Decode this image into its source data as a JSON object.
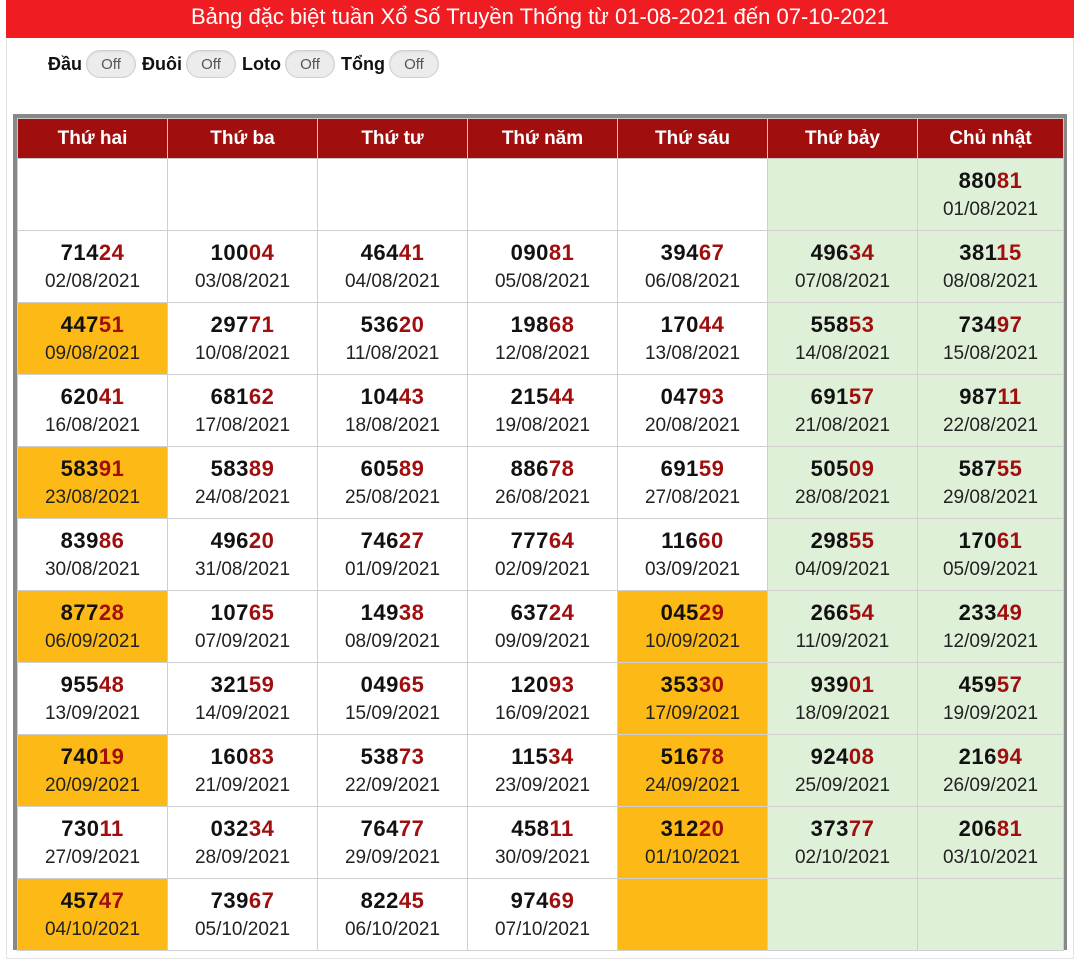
{
  "title": "Bảng đặc biệt tuần Xổ Số Truyền Thống từ 01-08-2021 đến 07-10-2021",
  "toggles": [
    {
      "label": "Đầu",
      "state": "Off"
    },
    {
      "label": "Đuôi",
      "state": "Off"
    },
    {
      "label": "Loto",
      "state": "Off"
    },
    {
      "label": "Tổng",
      "state": "Off"
    }
  ],
  "colors": {
    "title_bg": "#ef1c22",
    "header_bg": "#a10e0e",
    "last_digits": "#a10e0e",
    "weekend_bg": "#dff0d8",
    "highlight_bg": "#fdb915"
  },
  "headers": [
    "Thứ hai",
    "Thứ ba",
    "Thứ tư",
    "Thứ năm",
    "Thứ sáu",
    "Thứ bảy",
    "Chủ nhật"
  ],
  "rows": [
    [
      null,
      null,
      null,
      null,
      null,
      {
        "empty": true
      },
      {
        "num": "88081",
        "date": "01/08/2021"
      }
    ],
    [
      {
        "num": "71424",
        "date": "02/08/2021"
      },
      {
        "num": "10004",
        "date": "03/08/2021"
      },
      {
        "num": "46441",
        "date": "04/08/2021"
      },
      {
        "num": "09081",
        "date": "05/08/2021"
      },
      {
        "num": "39467",
        "date": "06/08/2021"
      },
      {
        "num": "49634",
        "date": "07/08/2021"
      },
      {
        "num": "38115",
        "date": "08/08/2021"
      }
    ],
    [
      {
        "num": "44751",
        "date": "09/08/2021",
        "hl": true
      },
      {
        "num": "29771",
        "date": "10/08/2021"
      },
      {
        "num": "53620",
        "date": "11/08/2021"
      },
      {
        "num": "19868",
        "date": "12/08/2021"
      },
      {
        "num": "17044",
        "date": "13/08/2021"
      },
      {
        "num": "55853",
        "date": "14/08/2021"
      },
      {
        "num": "73497",
        "date": "15/08/2021"
      }
    ],
    [
      {
        "num": "62041",
        "date": "16/08/2021"
      },
      {
        "num": "68162",
        "date": "17/08/2021"
      },
      {
        "num": "10443",
        "date": "18/08/2021"
      },
      {
        "num": "21544",
        "date": "19/08/2021"
      },
      {
        "num": "04793",
        "date": "20/08/2021"
      },
      {
        "num": "69157",
        "date": "21/08/2021"
      },
      {
        "num": "98711",
        "date": "22/08/2021"
      }
    ],
    [
      {
        "num": "58391",
        "date": "23/08/2021",
        "hl": true
      },
      {
        "num": "58389",
        "date": "24/08/2021"
      },
      {
        "num": "60589",
        "date": "25/08/2021"
      },
      {
        "num": "88678",
        "date": "26/08/2021"
      },
      {
        "num": "69159",
        "date": "27/08/2021"
      },
      {
        "num": "50509",
        "date": "28/08/2021"
      },
      {
        "num": "58755",
        "date": "29/08/2021"
      }
    ],
    [
      {
        "num": "83986",
        "date": "30/08/2021"
      },
      {
        "num": "49620",
        "date": "31/08/2021"
      },
      {
        "num": "74627",
        "date": "01/09/2021"
      },
      {
        "num": "77764",
        "date": "02/09/2021"
      },
      {
        "num": "11660",
        "date": "03/09/2021"
      },
      {
        "num": "29855",
        "date": "04/09/2021"
      },
      {
        "num": "17061",
        "date": "05/09/2021"
      }
    ],
    [
      {
        "num": "87728",
        "date": "06/09/2021",
        "hl": true
      },
      {
        "num": "10765",
        "date": "07/09/2021"
      },
      {
        "num": "14938",
        "date": "08/09/2021"
      },
      {
        "num": "63724",
        "date": "09/09/2021"
      },
      {
        "num": "04529",
        "date": "10/09/2021",
        "hl": true
      },
      {
        "num": "26654",
        "date": "11/09/2021"
      },
      {
        "num": "23349",
        "date": "12/09/2021"
      }
    ],
    [
      {
        "num": "95548",
        "date": "13/09/2021"
      },
      {
        "num": "32159",
        "date": "14/09/2021"
      },
      {
        "num": "04965",
        "date": "15/09/2021"
      },
      {
        "num": "12093",
        "date": "16/09/2021"
      },
      {
        "num": "35330",
        "date": "17/09/2021",
        "hl": true
      },
      {
        "num": "93901",
        "date": "18/09/2021"
      },
      {
        "num": "45957",
        "date": "19/09/2021"
      }
    ],
    [
      {
        "num": "74019",
        "date": "20/09/2021",
        "hl": true
      },
      {
        "num": "16083",
        "date": "21/09/2021"
      },
      {
        "num": "53873",
        "date": "22/09/2021"
      },
      {
        "num": "11534",
        "date": "23/09/2021"
      },
      {
        "num": "51678",
        "date": "24/09/2021",
        "hl": true
      },
      {
        "num": "92408",
        "date": "25/09/2021"
      },
      {
        "num": "21694",
        "date": "26/09/2021"
      }
    ],
    [
      {
        "num": "73011",
        "date": "27/09/2021"
      },
      {
        "num": "03234",
        "date": "28/09/2021"
      },
      {
        "num": "76477",
        "date": "29/09/2021"
      },
      {
        "num": "45811",
        "date": "30/09/2021"
      },
      {
        "num": "31220",
        "date": "01/10/2021",
        "hl": true
      },
      {
        "num": "37377",
        "date": "02/10/2021"
      },
      {
        "num": "20681",
        "date": "03/10/2021"
      }
    ],
    [
      {
        "num": "45747",
        "date": "04/10/2021",
        "hl": true
      },
      {
        "num": "73967",
        "date": "05/10/2021"
      },
      {
        "num": "82245",
        "date": "06/10/2021"
      },
      {
        "num": "97469",
        "date": "07/10/2021"
      },
      {
        "empty": true,
        "hl": true
      },
      {
        "empty": true
      },
      {
        "empty": true
      }
    ]
  ]
}
